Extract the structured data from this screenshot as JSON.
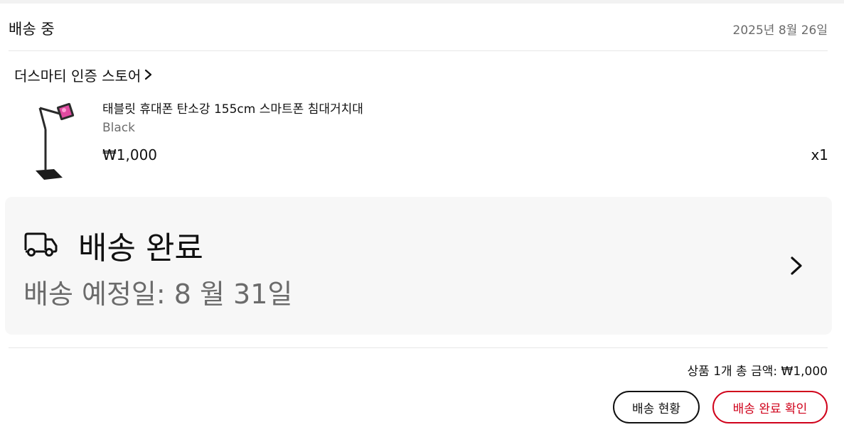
{
  "order": {
    "status_title": "배송 중",
    "date": "2025년 8월 26일"
  },
  "store": {
    "name": "더스마티 인증 스토어",
    "chevron_icon": "chevron-right-icon"
  },
  "product": {
    "name": "태블릿 휴대폰 탄소강 155cm 스마트폰 침대거치대",
    "option": "Black",
    "price": "₩1,000",
    "quantity": "x1",
    "image_icon": "tablet-stand-image"
  },
  "delivery": {
    "icon": "delivery-truck-icon",
    "status": "배송 완료",
    "eta": "배송 예정일: 8 월 31일",
    "chevron_icon": "chevron-right-icon"
  },
  "summary": {
    "total": "상품 1개 총 금액: ₩1,000"
  },
  "actions": {
    "tracking_label": "배송 현황",
    "confirm_label": "배송 완료 확인"
  },
  "colors": {
    "accent": "#d0021b",
    "card_background": "#f7f7f7",
    "muted_text": "#6b6b6b"
  }
}
